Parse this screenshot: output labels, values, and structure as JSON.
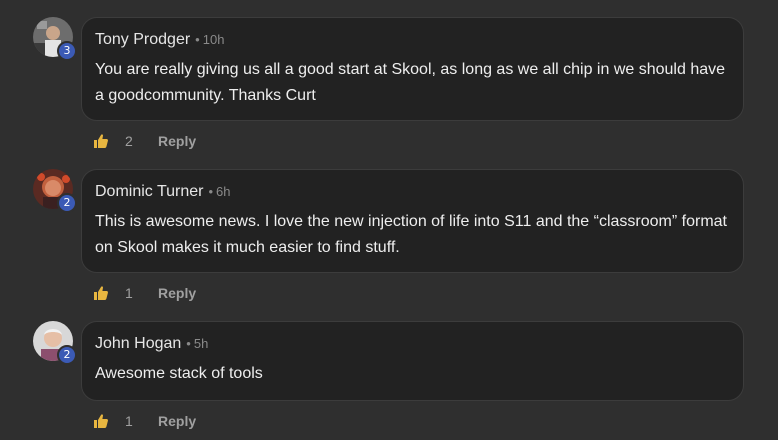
{
  "comments": [
    {
      "author": "Tony Prodger",
      "separator": "•",
      "time": "10h",
      "level": "3",
      "text": "You are really giving us all a good start at Skool, as long as we all chip in we should have a goodcommunity. Thanks Curt",
      "likes": "2",
      "reply_label": "Reply"
    },
    {
      "author": "Dominic Turner",
      "separator": "•",
      "time": "6h",
      "level": "2",
      "text": "This is awesome news. I love the new injection of life into S11 and the “classroom” format on Skool makes it much easier to find stuff.",
      "likes": "1",
      "reply_label": "Reply"
    },
    {
      "author": "John Hogan",
      "separator": "•",
      "time": "5h",
      "level": "2",
      "text": "Awesome stack of tools",
      "likes": "1",
      "reply_label": "Reply"
    }
  ],
  "colors": {
    "background": "#2f2f2f",
    "bubble": "#222222",
    "level_badge": "#3b5ab5",
    "like_icon": "#e8b640"
  },
  "icons": {
    "like": "thumbs-up-icon"
  }
}
